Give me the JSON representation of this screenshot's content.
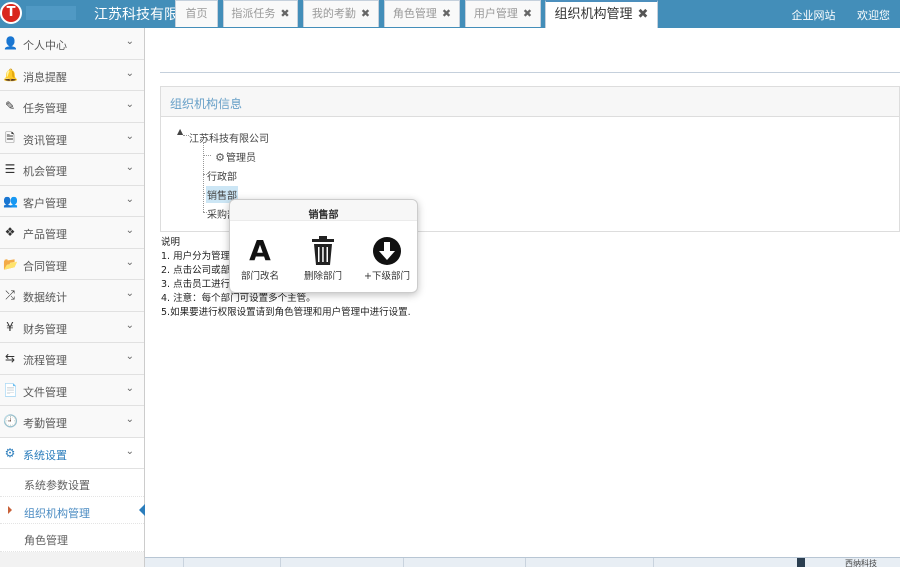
{
  "header": {
    "company": "江苏科技有限公司",
    "links": [
      "企业网站",
      "欢迎您"
    ]
  },
  "sidebar": {
    "items": [
      {
        "label": "个人中心",
        "icon": "user-icon",
        "glyph": "👤"
      },
      {
        "label": "消息提醒",
        "icon": "bell-icon",
        "glyph": "🔔"
      },
      {
        "label": "任务管理",
        "icon": "edit-icon",
        "glyph": "✎"
      },
      {
        "label": "资讯管理",
        "icon": "document-icon",
        "glyph": "🗎"
      },
      {
        "label": "机会管理",
        "icon": "list-icon",
        "glyph": "☰"
      },
      {
        "label": "客户管理",
        "icon": "users-icon",
        "glyph": "👥"
      },
      {
        "label": "产品管理",
        "icon": "dropbox-icon",
        "glyph": "❖"
      },
      {
        "label": "合同管理",
        "icon": "folder-open-icon",
        "glyph": "📂"
      },
      {
        "label": "数据统计",
        "icon": "shuffle-icon",
        "glyph": "⤮"
      },
      {
        "label": "财务管理",
        "icon": "yen-icon",
        "glyph": "¥"
      },
      {
        "label": "流程管理",
        "icon": "retweet-icon",
        "glyph": "⇆"
      },
      {
        "label": "文件管理",
        "icon": "file-icon",
        "glyph": "📄"
      },
      {
        "label": "考勤管理",
        "icon": "clock-icon",
        "glyph": "🕘"
      },
      {
        "label": "系统设置",
        "icon": "gear-icon",
        "glyph": "⚙"
      }
    ],
    "subitems": [
      {
        "label": "系统参数设置"
      },
      {
        "label": "组织机构管理"
      },
      {
        "label": "角色管理"
      }
    ]
  },
  "tabs": [
    {
      "label": "首页",
      "closable": false
    },
    {
      "label": "指派任务",
      "closable": true
    },
    {
      "label": "我的考勤",
      "closable": true
    },
    {
      "label": "角色管理",
      "closable": true
    },
    {
      "label": "用户管理",
      "closable": true
    },
    {
      "label": "组织机构管理",
      "closable": true
    }
  ],
  "panel": {
    "title": "组织机构信息",
    "tree": {
      "root": "江苏科技有限公司",
      "children": [
        "管理员",
        "行政部",
        "销售部",
        "采购部"
      ]
    }
  },
  "notes": {
    "heading": "说明",
    "lines": [
      "1. 用户分为管理",
      "2. 点击公司或部",
      "3. 点击员工进行",
      "4. 注意：每个部门可设置多个主管。",
      "5.如果要进行权限设置请到角色管理和用户管理中进行设置."
    ]
  },
  "popover": {
    "title": "销售部",
    "actions": [
      {
        "label": "部门改名",
        "icon": "font-icon",
        "glyph": "A"
      },
      {
        "label": "删除部门",
        "icon": "trash-icon",
        "glyph": "🗑"
      },
      {
        "label": "+下级部门",
        "icon": "arrow-circle-down-icon",
        "glyph": "⬇"
      }
    ]
  },
  "taskbar": {
    "trailing_text": "西纳科技"
  },
  "colors": {
    "header_bg": "#438eb9",
    "accent": "#2b7dbc",
    "logo_red": "#d9261c"
  }
}
